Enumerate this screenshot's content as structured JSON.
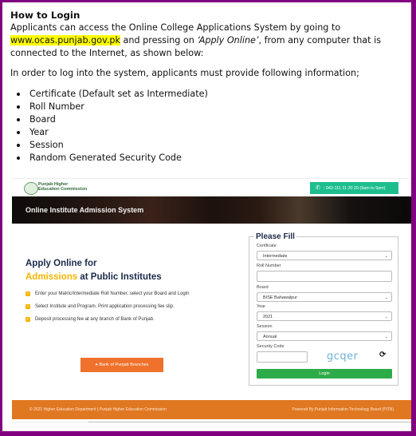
{
  "document": {
    "heading": "How to Login",
    "para1_before": "Applicants can access the Online College Applications System by going to ",
    "para1_link": "www.ocas.punjab.gov.pk",
    "para1_after1": " and pressing on ",
    "para1_italic": "‘Apply Online’",
    "para1_after2": ", from any computer that is connected to the Internet, as shown below:",
    "para2": "In order to log into the system, applicants must provide following information;",
    "bullets": [
      "Certificate (Default set as Intermediate)",
      "Roll Number",
      "Board",
      "Year",
      "Session",
      "Random Generated Security Code"
    ],
    "highlight_color": "#ffff00"
  },
  "screenshot": {
    "header": {
      "logo_line1": "Punjab Higher",
      "logo_line2": "Education Commission",
      "phone_icon": "phone-icon",
      "phone_text": ": 042-111 11 20 20 (9am to 5pm)",
      "phone_color": "#1dbe8e"
    },
    "banner": {
      "title": "Online Institute Admission System"
    },
    "intro": {
      "title_line1": "Apply Online for",
      "title_accent": "Admissions",
      "title_rest": " at Public Institutes",
      "accent_color": "#f5b400",
      "checks": [
        "Enter your Matric/Intermediate Roll Number, select your Board and Login",
        "Select Institute and Program. Print application processing fee slip.",
        "Deposit processing fee at any branch of Bank of Punjab."
      ],
      "bank_button": "Bank of Punjab Branches",
      "bank_button_icon": "map-marker-icon",
      "bank_button_color": "#f0712c"
    },
    "form": {
      "legend": "Please Fill",
      "certificate_label": "Certificate",
      "certificate_value": "Intermediate",
      "roll_label": "Roll Number",
      "roll_value": "",
      "board_label": "Board",
      "board_value": "BISE Bahawalpur",
      "year_label": "Year",
      "year_value": "2021",
      "session_label": "Session",
      "session_value": "Annual",
      "security_label": "Security Code",
      "security_value": "",
      "captcha_text": "gcqer",
      "refresh_icon": "refresh-icon",
      "login_button": "Login",
      "login_color": "#2eab49"
    },
    "footer": {
      "left": "© 2021 Higher Education Department | Punjab Higher Education Commission",
      "right": "Powered By Punjab Information Technology Board (PITB)",
      "color": "#e07822"
    }
  }
}
